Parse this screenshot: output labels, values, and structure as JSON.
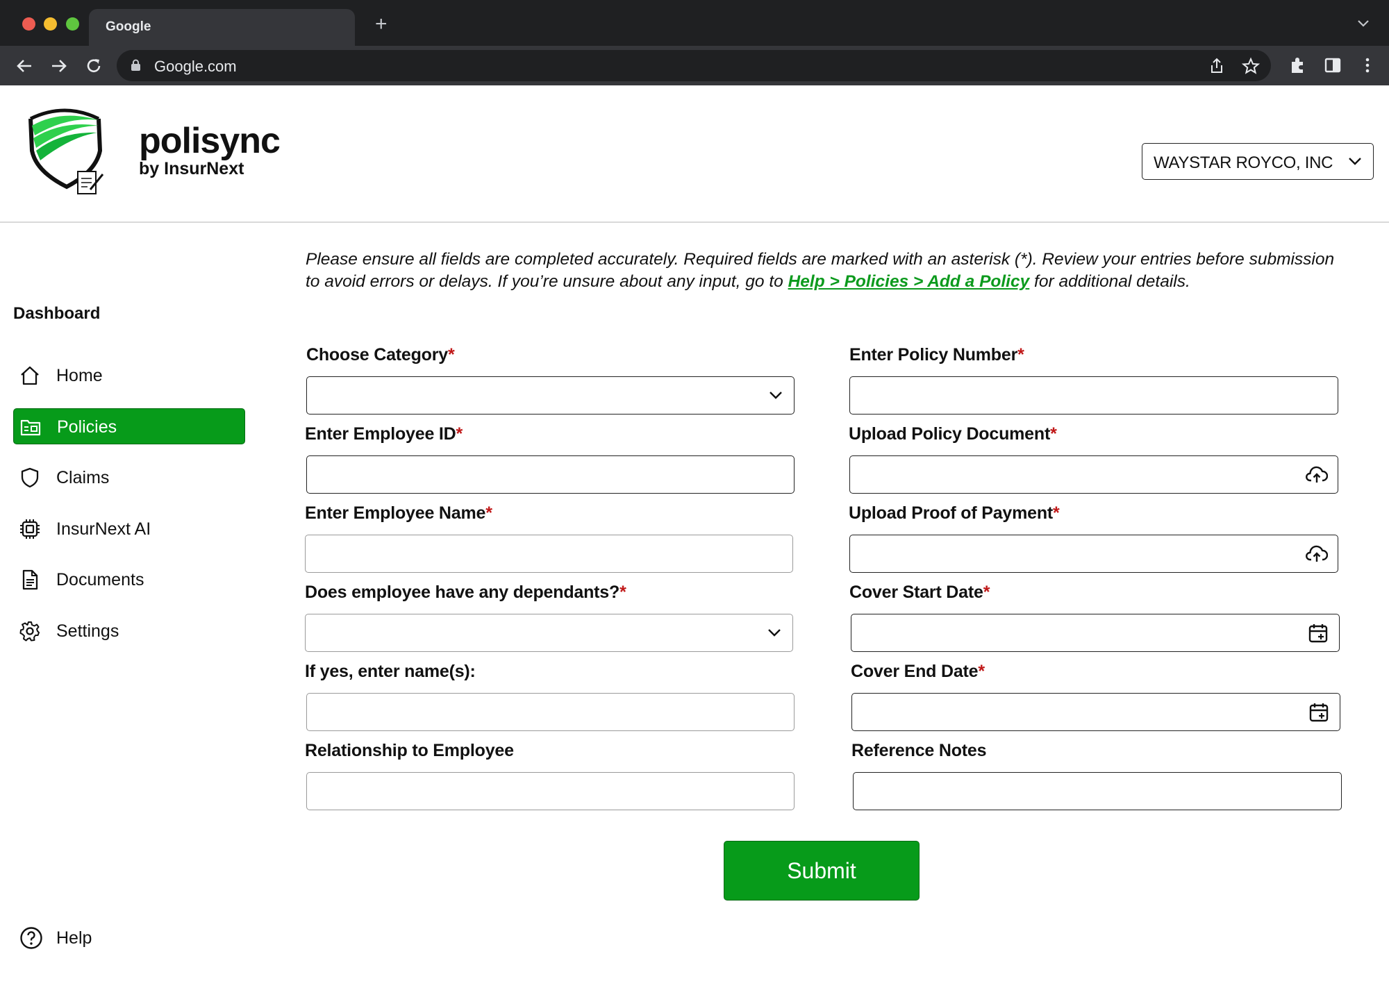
{
  "browser": {
    "tab_title": "Google",
    "url": "Google.com"
  },
  "header": {
    "brand_name": "polisync",
    "brand_sub": "by InsurNext",
    "company": "WAYSTAR ROYCO, INC"
  },
  "sidebar": {
    "heading": "Dashboard",
    "items": [
      {
        "label": "Home",
        "icon": "home-icon"
      },
      {
        "label": "Policies",
        "icon": "folder-id-icon",
        "active": true
      },
      {
        "label": "Claims",
        "icon": "shield-icon"
      },
      {
        "label": "InsurNext AI",
        "icon": "chip-icon"
      },
      {
        "label": "Documents",
        "icon": "document-icon"
      },
      {
        "label": "Settings",
        "icon": "gear-icon"
      }
    ],
    "help": "Help"
  },
  "intro": {
    "text_before": "Please ensure all fields are completed accurately. Required fields are marked with an asterisk (*). Review your entries before submission to avoid errors or delays. If you’re unsure about any input, go to ",
    "link": "Help > Policies > Add a Policy",
    "text_after": " for additional details."
  },
  "form": {
    "left": [
      {
        "label": "Choose Category",
        "required": "*",
        "type": "select",
        "value": ""
      },
      {
        "label": "Enter Employee ID",
        "required": "*",
        "type": "text",
        "value": ""
      },
      {
        "label": "Enter Employee Name",
        "required": "*",
        "type": "text",
        "value": ""
      },
      {
        "label": "Does employee have any dependants?",
        "required": "*",
        "type": "select",
        "value": ""
      },
      {
        "label": "If yes, enter name(s):",
        "required": "",
        "type": "text",
        "value": ""
      },
      {
        "label": "Relationship to Employee",
        "required": "",
        "type": "text",
        "value": ""
      }
    ],
    "right": [
      {
        "label": "Enter Policy Number",
        "required": "*",
        "type": "text",
        "value": ""
      },
      {
        "label": "Upload Policy Document",
        "required": "*",
        "type": "upload",
        "value": ""
      },
      {
        "label": "Upload Proof of Payment",
        "required": "*",
        "type": "upload",
        "value": ""
      },
      {
        "label": "Cover Start Date",
        "required": "*",
        "type": "date",
        "value": ""
      },
      {
        "label": "Cover End Date",
        "required": "*",
        "type": "date",
        "value": ""
      },
      {
        "label": "Reference Notes",
        "required": "",
        "type": "text",
        "value": ""
      }
    ],
    "submit_label": "Submit"
  },
  "colors": {
    "brand_green": "#079b1a",
    "link_green": "#0c9a1d",
    "required_red": "#c01818",
    "chrome_dark": "#1f2022"
  }
}
